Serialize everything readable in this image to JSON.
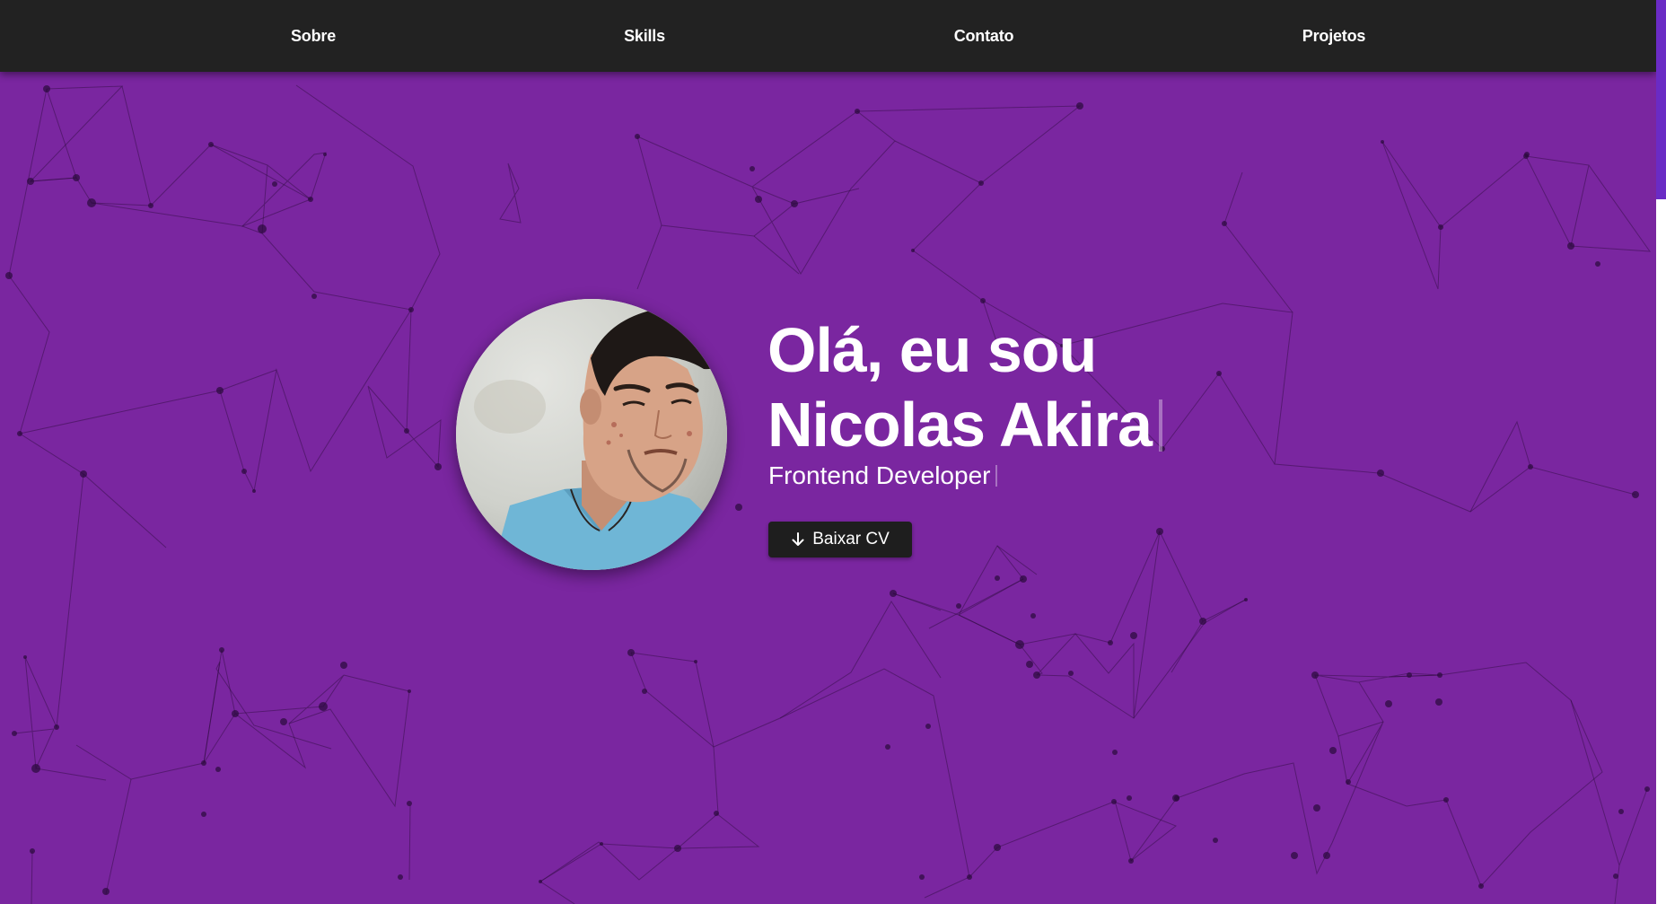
{
  "nav": {
    "items": [
      {
        "label": "Sobre"
      },
      {
        "label": "Skills"
      },
      {
        "label": "Contato"
      },
      {
        "label": "Projetos"
      }
    ]
  },
  "hero": {
    "greeting": "Olá, eu sou",
    "name": "Nicolas Akira",
    "role": "Frontend Developer",
    "cv_button": {
      "label": "Baixar CV",
      "icon": "arrow-down-icon"
    },
    "avatar": {
      "description_icon": "profile-photo"
    }
  },
  "colors": {
    "background": "#7a26a0",
    "navbar": "#222222",
    "button": "#1e1e1e",
    "scroll_thumb": "#6a2bc5"
  }
}
